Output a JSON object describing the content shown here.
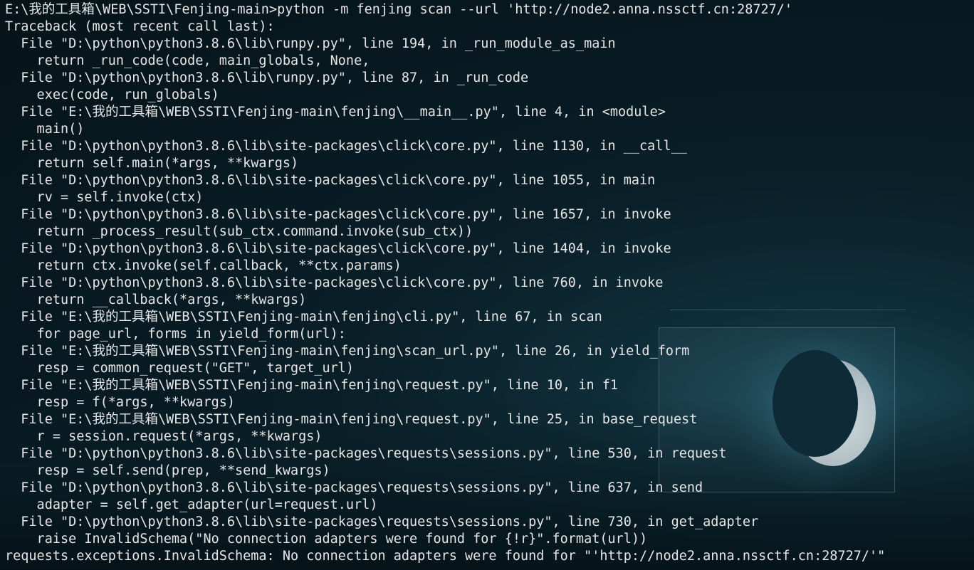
{
  "terminal": {
    "lines": [
      "E:\\我的工具箱\\WEB\\SSTI\\Fenjing-main>python -m fenjing scan --url 'http://node2.anna.nssctf.cn:28727/'",
      "Traceback (most recent call last):",
      "  File \"D:\\python\\python3.8.6\\lib\\runpy.py\", line 194, in _run_module_as_main",
      "    return _run_code(code, main_globals, None,",
      "  File \"D:\\python\\python3.8.6\\lib\\runpy.py\", line 87, in _run_code",
      "    exec(code, run_globals)",
      "  File \"E:\\我的工具箱\\WEB\\SSTI\\Fenjing-main\\fenjing\\__main__.py\", line 4, in <module>",
      "    main()",
      "  File \"D:\\python\\python3.8.6\\lib\\site-packages\\click\\core.py\", line 1130, in __call__",
      "    return self.main(*args, **kwargs)",
      "  File \"D:\\python\\python3.8.6\\lib\\site-packages\\click\\core.py\", line 1055, in main",
      "    rv = self.invoke(ctx)",
      "  File \"D:\\python\\python3.8.6\\lib\\site-packages\\click\\core.py\", line 1657, in invoke",
      "    return _process_result(sub_ctx.command.invoke(sub_ctx))",
      "  File \"D:\\python\\python3.8.6\\lib\\site-packages\\click\\core.py\", line 1404, in invoke",
      "    return ctx.invoke(self.callback, **ctx.params)",
      "  File \"D:\\python\\python3.8.6\\lib\\site-packages\\click\\core.py\", line 760, in invoke",
      "    return __callback(*args, **kwargs)",
      "  File \"E:\\我的工具箱\\WEB\\SSTI\\Fenjing-main\\fenjing\\cli.py\", line 67, in scan",
      "    for page_url, forms in yield_form(url):",
      "  File \"E:\\我的工具箱\\WEB\\SSTI\\Fenjing-main\\fenjing\\scan_url.py\", line 26, in yield_form",
      "    resp = common_request(\"GET\", target_url)",
      "  File \"E:\\我的工具箱\\WEB\\SSTI\\Fenjing-main\\fenjing\\request.py\", line 10, in f1",
      "    resp = f(*args, **kwargs)",
      "  File \"E:\\我的工具箱\\WEB\\SSTI\\Fenjing-main\\fenjing\\request.py\", line 25, in base_request",
      "    r = session.request(*args, **kwargs)",
      "  File \"D:\\python\\python3.8.6\\lib\\site-packages\\requests\\sessions.py\", line 530, in request",
      "    resp = self.send(prep, **send_kwargs)",
      "  File \"D:\\python\\python3.8.6\\lib\\site-packages\\requests\\sessions.py\", line 637, in send",
      "    adapter = self.get_adapter(url=request.url)",
      "  File \"D:\\python\\python3.8.6\\lib\\site-packages\\requests\\sessions.py\", line 730, in get_adapter",
      "    raise InvalidSchema(\"No connection adapters were found for {!r}\".format(url))",
      "requests.exceptions.InvalidSchema: No connection adapters were found for \"'http://node2.anna.nssctf.cn:28727/'\""
    ]
  },
  "colors": {
    "text": "#e6e6e6",
    "background": "#071820",
    "accent_glow": "#1d4a5a"
  }
}
